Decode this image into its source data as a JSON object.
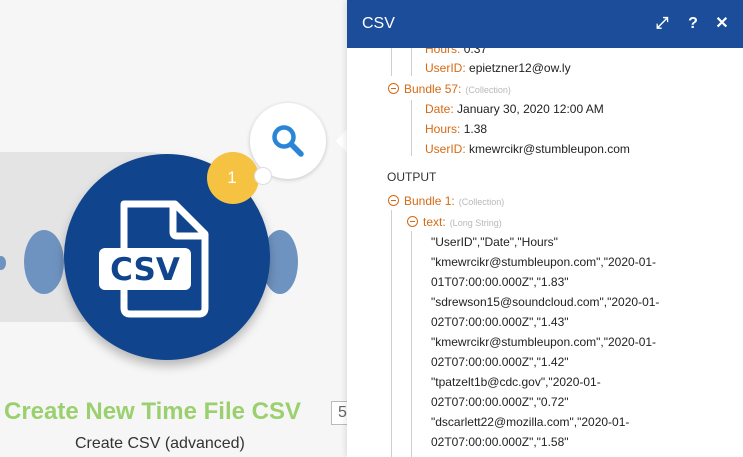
{
  "module": {
    "title": "Create New Time File CSV",
    "id": "5",
    "subtitle": "Create CSV (advanced)",
    "operation_count": "1",
    "icon_text": "CSV",
    "accent_color": "#10458d",
    "title_color": "#9bd06f",
    "badge_color": "#f5c242"
  },
  "panel": {
    "title": "CSV",
    "header_color": "#1b4d9a",
    "buttons": {
      "expand": "⤢",
      "help": "?",
      "close": "✕"
    },
    "input_partial": {
      "hours_label": "Hours:",
      "hours_value": "0.37",
      "userid_label": "UserID:",
      "userid_value": "epietzner12@ow.ly"
    },
    "bundle57": {
      "label": "Bundle 57:",
      "type": "(Collection)",
      "fields": [
        {
          "key": "Date:",
          "value": "January 30, 2020 12:00 AM"
        },
        {
          "key": "Hours:",
          "value": "1.38"
        },
        {
          "key": "UserID:",
          "value": "kmewrcikr@stumbleupon.com"
        }
      ]
    },
    "output": {
      "label": "OUTPUT",
      "bundle": {
        "label": "Bundle 1:",
        "type": "(Collection)"
      },
      "text_key": "text:",
      "text_type": "(Long String)",
      "text_lines": [
        "\"UserID\",\"Date\",\"Hours\"",
        "\"kmewrcikr@stumbleupon.com\",\"2020-01-",
        "01T07:00:00.000Z\",\"1.83\"",
        "\"sdrewson15@soundcloud.com\",\"2020-01-",
        "02T07:00:00.000Z\",\"1.43\"",
        "\"kmewrcikr@stumbleupon.com\",\"2020-01-",
        "02T07:00:00.000Z\",\"1.42\"",
        "\"tpatzelt1b@cdc.gov\",\"2020-01-",
        "02T07:00:00.000Z\",\"0.72\"",
        "\"dscarlett22@mozilla.com\",\"2020-01-",
        "02T07:00:00.000Z\",\"1.58\""
      ]
    }
  }
}
